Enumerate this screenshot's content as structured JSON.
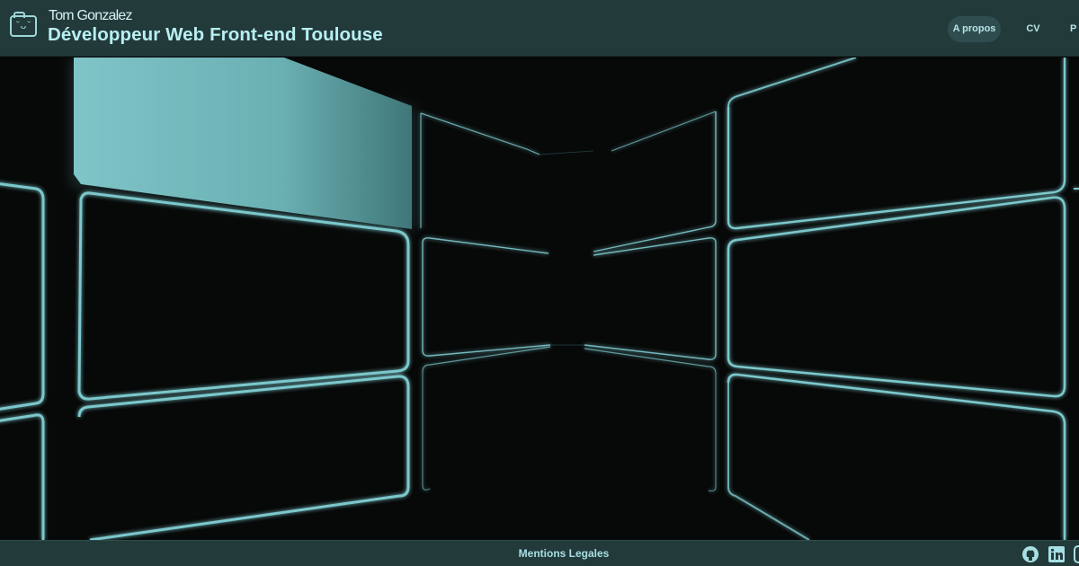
{
  "header": {
    "logo_icon": "folder-smile-icon",
    "logo_face": "˘ᴗ˘",
    "name": "Tom Gonzalez",
    "tagline": "Développeur Web Front-end Toulouse",
    "nav": [
      {
        "label": "A propos",
        "active": true
      },
      {
        "label": "CV",
        "active": false
      },
      {
        "label": "P",
        "active": false
      }
    ]
  },
  "hero": {
    "theme": "window-grid-hallway",
    "accent": "#7cc8cc",
    "background": "#070808"
  },
  "footer": {
    "link": "Mentions Legales",
    "social": [
      "github-icon",
      "linkedin-icon",
      "contact-icon"
    ]
  },
  "colors": {
    "bar": "#233a3b",
    "text": "#b8eff2"
  }
}
